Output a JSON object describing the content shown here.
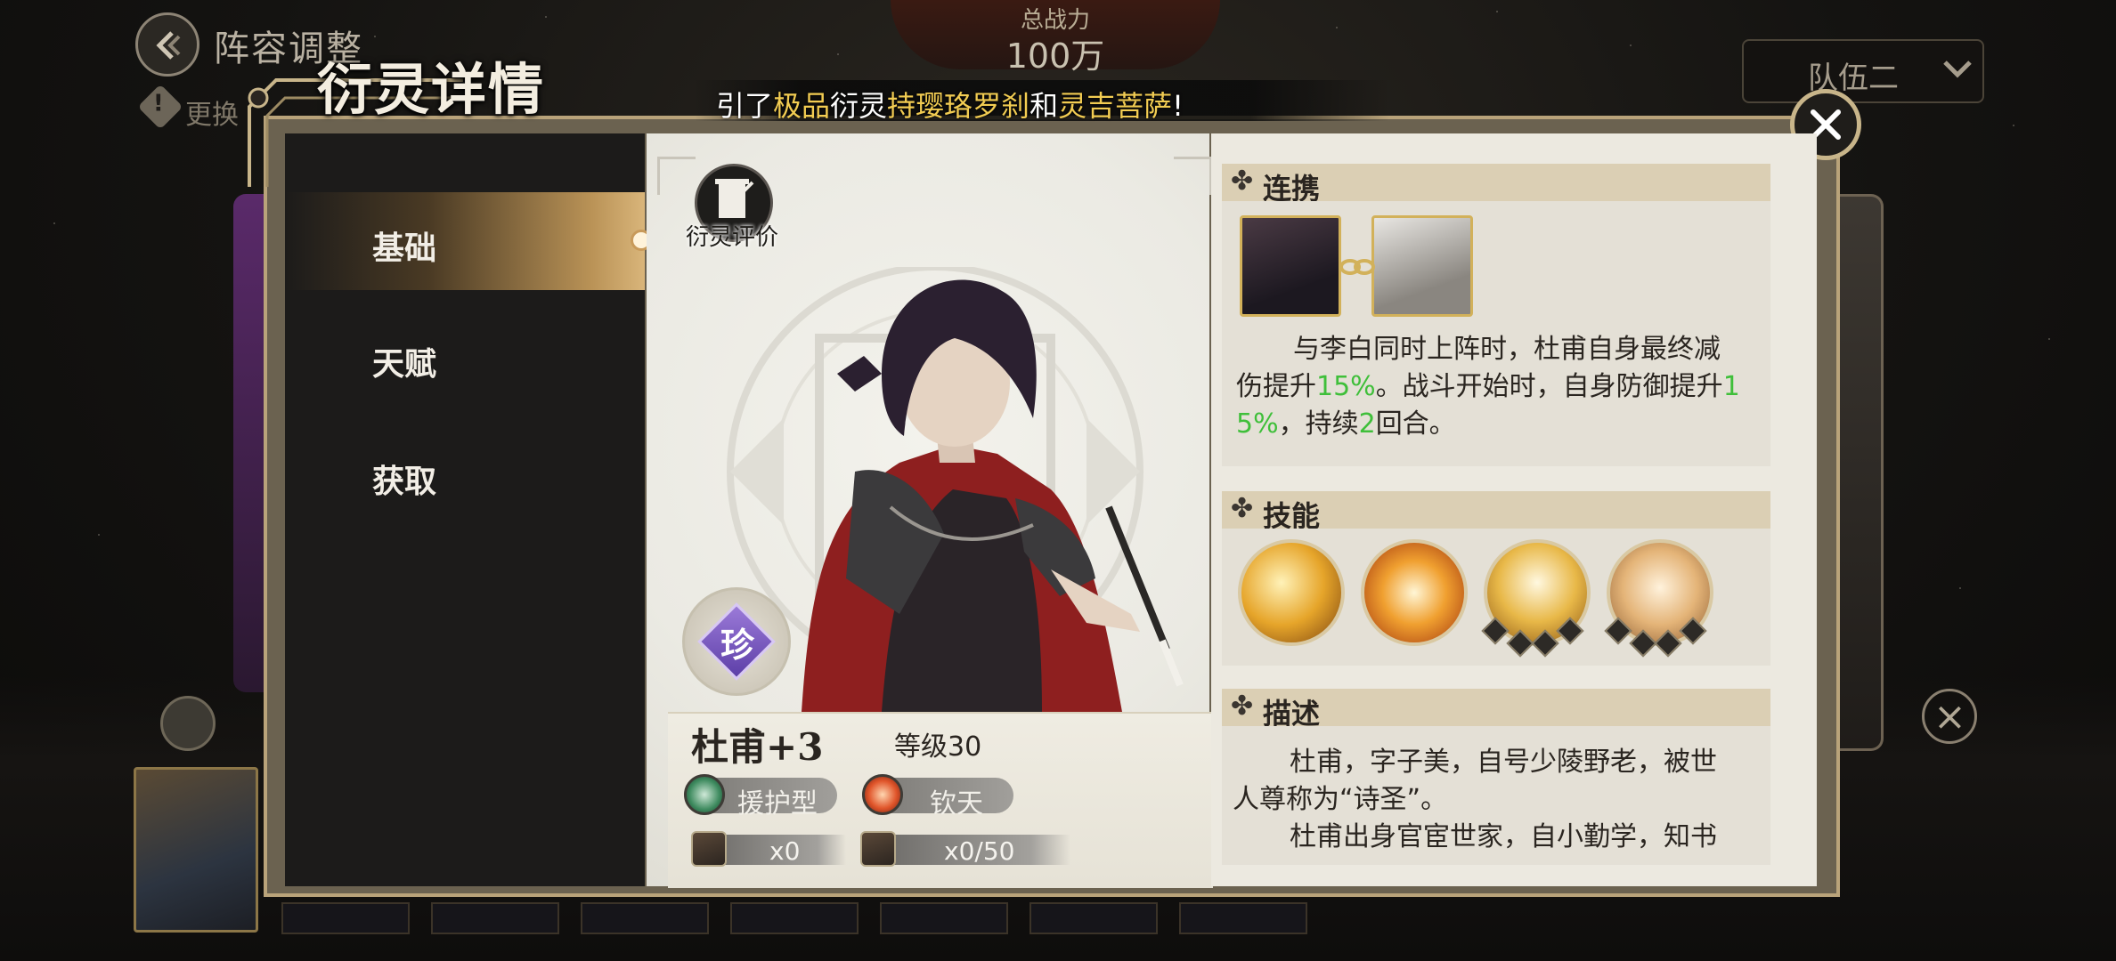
{
  "background": {
    "title": "阵容调整",
    "warning_text": "更换",
    "power_label": "总战力",
    "power_value": "100万",
    "team_select_value": "队伍二"
  },
  "modal": {
    "title": "衍灵详情",
    "ticker": {
      "prefix": "引了",
      "hl1": "极品",
      "mid1": "衍灵",
      "hl2": "持璎珞罗刹",
      "mid2": "和",
      "hl3": "灵吉菩萨",
      "suffix": "!"
    }
  },
  "sidebar": {
    "items": [
      {
        "label": "基础",
        "selected": true
      },
      {
        "label": "天赋",
        "selected": false
      },
      {
        "label": "获取",
        "selected": false
      }
    ]
  },
  "character": {
    "eval_label": "衍灵评价",
    "rarity": "珍",
    "name": "杜甫+3",
    "level": "等级30",
    "role_tag": "援护型",
    "faction_tag": "钦天",
    "shard_count": "x0",
    "soul_count": "x0/50"
  },
  "sections": {
    "link": {
      "title": "连携",
      "text": {
        "t1": "与李白同时上阵时，杜甫自身最终减",
        "t2a": "伤提升",
        "t2b": "15%",
        "t2c": "。战斗开始时，自身防御提升",
        "t2d": "1",
        "t3a": "5%",
        "t3b": "，持续",
        "t3c": "2",
        "t3d": "回合。"
      }
    },
    "skills": {
      "title": "技能"
    },
    "description": {
      "title": "描述",
      "lines": [
        "杜甫，字子美，自号少陵野老，被世",
        "人尊称为“诗圣”。",
        "杜甫出身官宦世家，自小勤学，知书"
      ]
    }
  },
  "colors": {
    "accent_gold": "#c8b58a",
    "highlight_green": "#3fbf3a",
    "ticker_highlight": "#f2cc52"
  }
}
